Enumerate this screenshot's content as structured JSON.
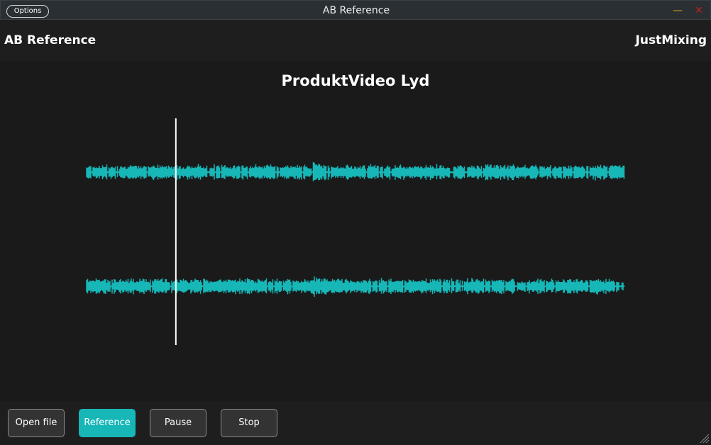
{
  "window": {
    "title": "AB Reference",
    "options_label": "Options",
    "minimize_icon": "minimize-icon",
    "close_icon": "close-icon",
    "minimize_color": "#e0a020",
    "close_color": "#c02020"
  },
  "header": {
    "app_name": "AB Reference",
    "brand": "JustMixing"
  },
  "main": {
    "track_title": "ProduktVideo Lyd",
    "waveform_color": "#17b6b7",
    "channels": 2,
    "playhead_fraction": 0.166
  },
  "controls": {
    "open_file": "Open file",
    "reference": "Reference",
    "pause": "Pause",
    "stop": "Stop",
    "accent": "#17b6b7"
  }
}
